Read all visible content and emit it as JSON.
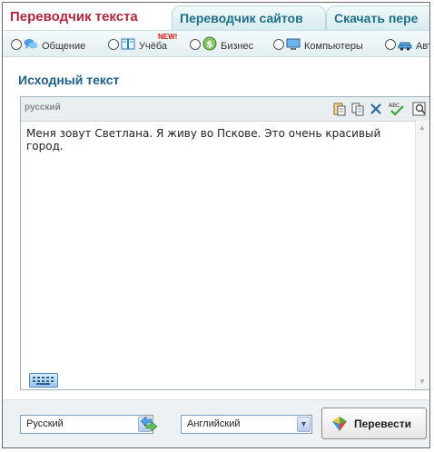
{
  "tabs": [
    {
      "label": "Переводчик текста",
      "active": true
    },
    {
      "label": "Переводчик сайтов",
      "active": false
    },
    {
      "label": "Скачать пере",
      "active": false
    }
  ],
  "categories": [
    {
      "label": "Общение",
      "icon": "chat-bubbles-icon"
    },
    {
      "label": "Учёба",
      "icon": "book-icon",
      "badge": "NEW!"
    },
    {
      "label": "Бизнес",
      "icon": "dollar-coin-icon"
    },
    {
      "label": "Компьютеры",
      "icon": "computer-monitor-icon"
    },
    {
      "label": "Авто",
      "icon": "car-icon"
    }
  ],
  "source": {
    "section_title": "Исходный текст",
    "language_label": "русский",
    "text": "Меня зовут Светлана. Я живу во Пскове. Это очень красивый город."
  },
  "toolbar_icons": [
    "paste-icon",
    "copy-icon",
    "clear-icon",
    "spellcheck-icon",
    "preview-icon"
  ],
  "bottom": {
    "source_lang": "Русский",
    "target_lang": "Английский",
    "translate_label": "Перевести"
  },
  "colors": {
    "active_tab": "#b0263c",
    "tab_text": "#1f6f8b",
    "section_title": "#1f5f8b"
  }
}
